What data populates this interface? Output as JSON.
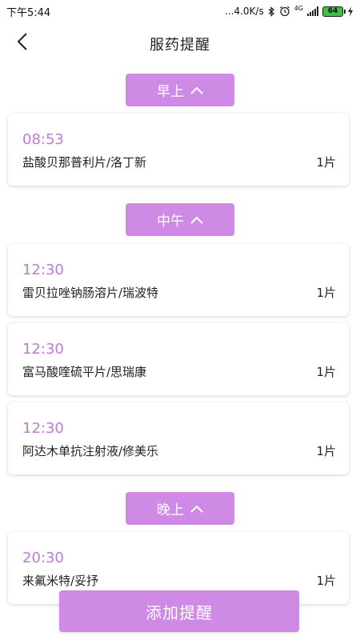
{
  "status_bar": {
    "time": "下午5:44",
    "network_speed": "...4.0K/s",
    "network_type": "4G",
    "battery": "64",
    "icons": [
      "bluetooth-icon",
      "alarm-icon",
      "signal-icon",
      "battery-icon",
      "charging-icon"
    ]
  },
  "header": {
    "title": "服药提醒",
    "back_icon": "chevron-left-icon"
  },
  "sections": [
    {
      "label": "早上",
      "icon": "chevron-up-icon",
      "items": [
        {
          "time": "08:53",
          "name": "盐酸贝那普利片/洛丁新",
          "qty": "1片"
        }
      ]
    },
    {
      "label": "中午",
      "icon": "chevron-up-icon",
      "items": [
        {
          "time": "12:30",
          "name": "雷贝拉唑钠肠溶片/瑞波特",
          "qty": "1片"
        },
        {
          "time": "12:30",
          "name": "富马酸喹硫平片/思瑞康",
          "qty": "1片"
        },
        {
          "time": "12:30",
          "name": "阿达木单抗注射液/修美乐",
          "qty": "1片"
        }
      ]
    },
    {
      "label": "晚上",
      "icon": "chevron-up-icon",
      "items": [
        {
          "time": "20:30",
          "name": "来氟米特/妥抒",
          "qty": "1片"
        }
      ]
    }
  ],
  "add_button": {
    "label": "添加提醒"
  },
  "colors": {
    "accent": "#cf8ae6",
    "time_text": "#c07ad8"
  }
}
